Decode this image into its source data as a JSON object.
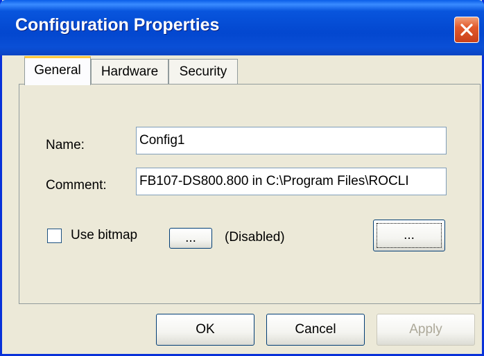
{
  "window": {
    "title": "Configuration Properties",
    "close_label": "close"
  },
  "tabs": [
    {
      "label": "General",
      "active": true
    },
    {
      "label": "Hardware",
      "active": false
    },
    {
      "label": "Security",
      "active": false
    }
  ],
  "general": {
    "name_label": "Name:",
    "name_value": "Config1",
    "comment_label": "Comment:",
    "comment_value": "FB107-DS800.800 in C:\\Program Files\\ROCLI",
    "use_bitmap_label": "Use bitmap",
    "use_bitmap_checked": false,
    "browse_label": "...",
    "disabled_text": "(Disabled)",
    "preview_label": "..."
  },
  "footer": {
    "ok_label": "OK",
    "cancel_label": "Cancel",
    "apply_label": "Apply"
  },
  "colors": {
    "titlebar": "#0347cf",
    "close_button": "#e25a2c",
    "dialog_bg": "#ece9d8",
    "active_tab_accent": "#ffc73c"
  }
}
